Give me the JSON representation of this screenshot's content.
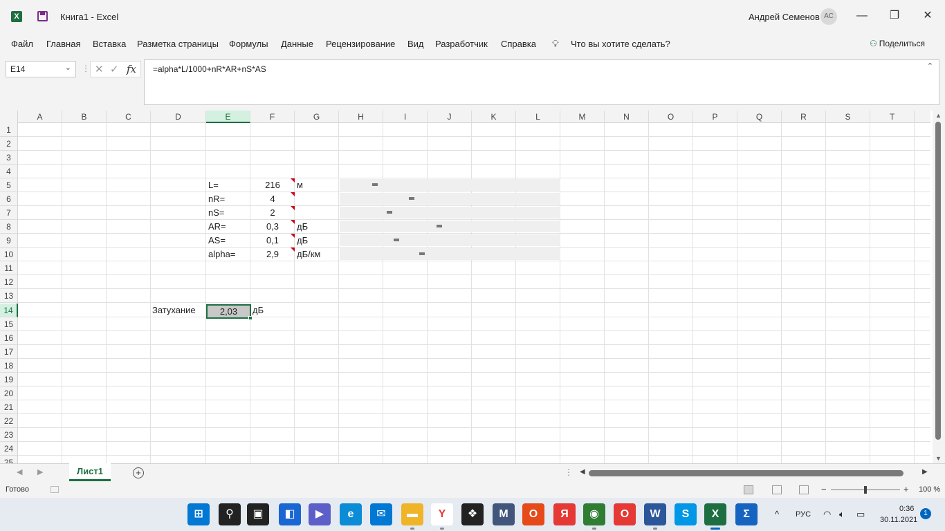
{
  "window": {
    "title": "Книга1  -  Excel",
    "user_name": "Андрей Семенов",
    "user_initials": "АС",
    "minimize": "—",
    "maximize": "❐",
    "close": "✕"
  },
  "ribbon": {
    "tabs": [
      "Файл",
      "Главная",
      "Вставка",
      "Разметка страницы",
      "Формулы",
      "Данные",
      "Рецензирование",
      "Вид",
      "Разработчик",
      "Справка"
    ],
    "tell_me": "Что вы хотите сделать?",
    "share": "Поделиться"
  },
  "formula_bar": {
    "name_box": "E14",
    "formula": "=alpha*L/1000+nR*AR+nS*AS",
    "cancel_symbol": "✕",
    "enter_symbol": "✓",
    "fx_symbol": "fx"
  },
  "grid": {
    "columns": [
      "A",
      "B",
      "C",
      "D",
      "E",
      "F",
      "G",
      "H",
      "I",
      "J",
      "K",
      "L",
      "M",
      "N",
      "O",
      "P",
      "Q",
      "R",
      "S",
      "T"
    ],
    "rows": [
      "1",
      "2",
      "3",
      "4",
      "5",
      "6",
      "7",
      "8",
      "9",
      "10",
      "11",
      "12",
      "13",
      "14",
      "15",
      "16",
      "17",
      "18",
      "19",
      "20",
      "21",
      "22",
      "23",
      "24",
      "25"
    ],
    "active_column": "E",
    "active_row": "14",
    "params": [
      {
        "label": "L=",
        "value": "216",
        "unit": "м",
        "slider": 0.15
      },
      {
        "label": "nR=",
        "value": "4",
        "unit": "",
        "slider": 0.32
      },
      {
        "label": "nS=",
        "value": "2",
        "unit": "",
        "slider": 0.22
      },
      {
        "label": "AR=",
        "value": "0,3",
        "unit": "дБ",
        "slider": 0.45
      },
      {
        "label": "AS=",
        "value": "0,1",
        "unit": "дБ",
        "slider": 0.25
      },
      {
        "label": "alpha=",
        "value": "2,9",
        "unit": "дБ/км",
        "slider": 0.37
      }
    ],
    "result": {
      "label": "Затухание",
      "value": "2,03",
      "unit": "дБ"
    }
  },
  "sheets": {
    "active": "Лист1",
    "add_symbol": "+",
    "options_dots": "⋮"
  },
  "status": {
    "ready": "Готово",
    "zoom": "100 %",
    "zoom_minus": "−",
    "zoom_plus": "+"
  },
  "taskbar": {
    "apps": [
      {
        "name": "start",
        "glyph": "⊞",
        "color": "#0078d4"
      },
      {
        "name": "search",
        "glyph": "⚲",
        "color": "#222222"
      },
      {
        "name": "task-view",
        "glyph": "▣",
        "color": "#222222"
      },
      {
        "name": "widgets",
        "glyph": "◧",
        "color": "#1967d2"
      },
      {
        "name": "teams",
        "glyph": "▶",
        "color": "#5b5fc7"
      },
      {
        "name": "edge",
        "glyph": "e",
        "color": "#0c8bd6"
      },
      {
        "name": "mail",
        "glyph": "✉",
        "color": "#0078d4"
      },
      {
        "name": "explorer",
        "glyph": "▬",
        "color": "#f0b429"
      },
      {
        "name": "yandex",
        "glyph": "Y",
        "color": "#ffffff"
      },
      {
        "name": "dropbox",
        "glyph": "❖",
        "color": "#222222"
      },
      {
        "name": "malwarebytes",
        "glyph": "M",
        "color": "#41567a"
      },
      {
        "name": "office",
        "glyph": "O",
        "color": "#e64a19"
      },
      {
        "name": "yandex-browser",
        "glyph": "Я",
        "color": "#e53935"
      },
      {
        "name": "geogebra",
        "glyph": "◉",
        "color": "#2e7d32"
      },
      {
        "name": "opera",
        "glyph": "O",
        "color": "#e53935"
      },
      {
        "name": "word",
        "glyph": "W",
        "color": "#2b579a"
      },
      {
        "name": "skype",
        "glyph": "S",
        "color": "#0098e6"
      },
      {
        "name": "excel",
        "glyph": "X",
        "color": "#1d6f42"
      },
      {
        "name": "mathtype",
        "glyph": "Σ",
        "color": "#1565c0"
      }
    ],
    "tray": {
      "chevron": "^",
      "language": "РУС",
      "time": "0:36",
      "date": "30.11.2021",
      "notifications": "1"
    }
  }
}
